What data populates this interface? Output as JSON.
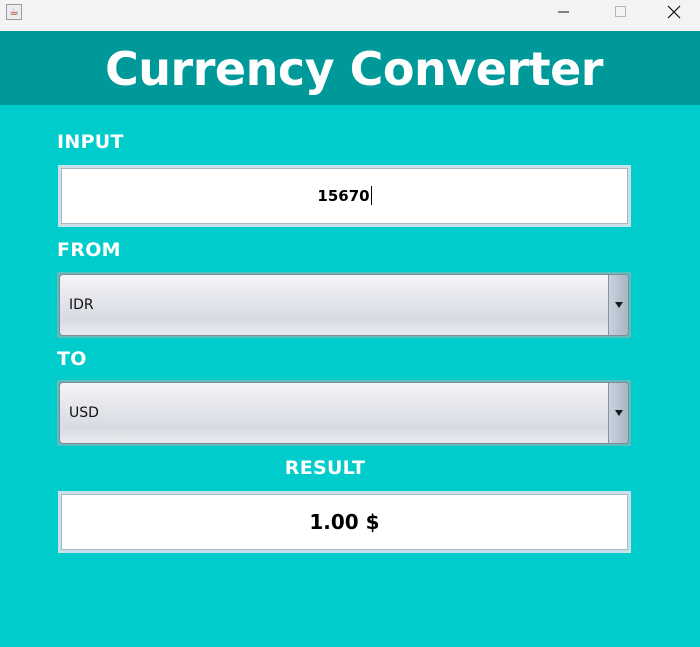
{
  "window": {
    "icon": "java-cup-icon",
    "controls": [
      "minimize-icon",
      "maximize-icon",
      "close-icon"
    ]
  },
  "header": {
    "title": "Currency Converter"
  },
  "input": {
    "label": "INPUT",
    "value": "15670"
  },
  "from": {
    "label": "FROM",
    "selected": "IDR"
  },
  "to": {
    "label": "TO",
    "selected": "USD"
  },
  "result": {
    "label": "RESULT",
    "value": "1.00 $"
  },
  "colors": {
    "background": "#00cccc",
    "header": "#009999",
    "label_text": "#ffffff"
  }
}
